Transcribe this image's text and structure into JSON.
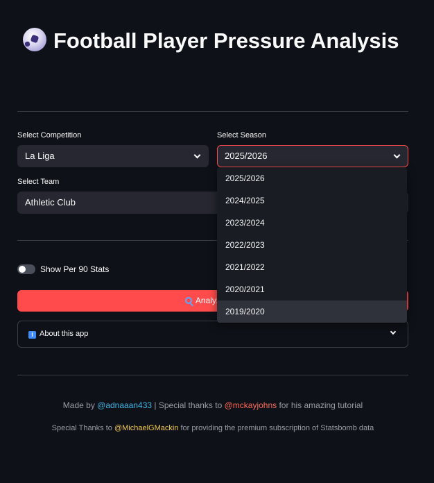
{
  "title": "Football Player Pressure Analysis",
  "competition": {
    "label": "Select Competition",
    "value": "La Liga"
  },
  "season": {
    "label": "Select Season",
    "value": "2025/2026",
    "options": [
      "2025/2026",
      "2024/2025",
      "2023/2024",
      "2022/2023",
      "2021/2022",
      "2020/2021",
      "2019/2020"
    ]
  },
  "team": {
    "label": "Select Team",
    "value": "Athletic Club"
  },
  "toggle": {
    "label": "Show Per 90 Stats",
    "on": false
  },
  "analyze_button": {
    "label": "Analyze Top"
  },
  "about": {
    "label": "About this app"
  },
  "footer": {
    "made_by_prefix": "Made by ",
    "author": "@adnaaan433",
    "thanks_prefix": " | Special thanks to ",
    "thanks_user": "@mckayjohns",
    "thanks_suffix": " for his amazing tutorial",
    "premium_prefix": "Special Thanks to ",
    "premium_user": "@MichaelGMackin",
    "premium_suffix": " for providing the premium subscription of Statsbomb data"
  },
  "colors": {
    "accent": "#ff4b4b",
    "background": "#0e1117",
    "input": "#262730"
  }
}
